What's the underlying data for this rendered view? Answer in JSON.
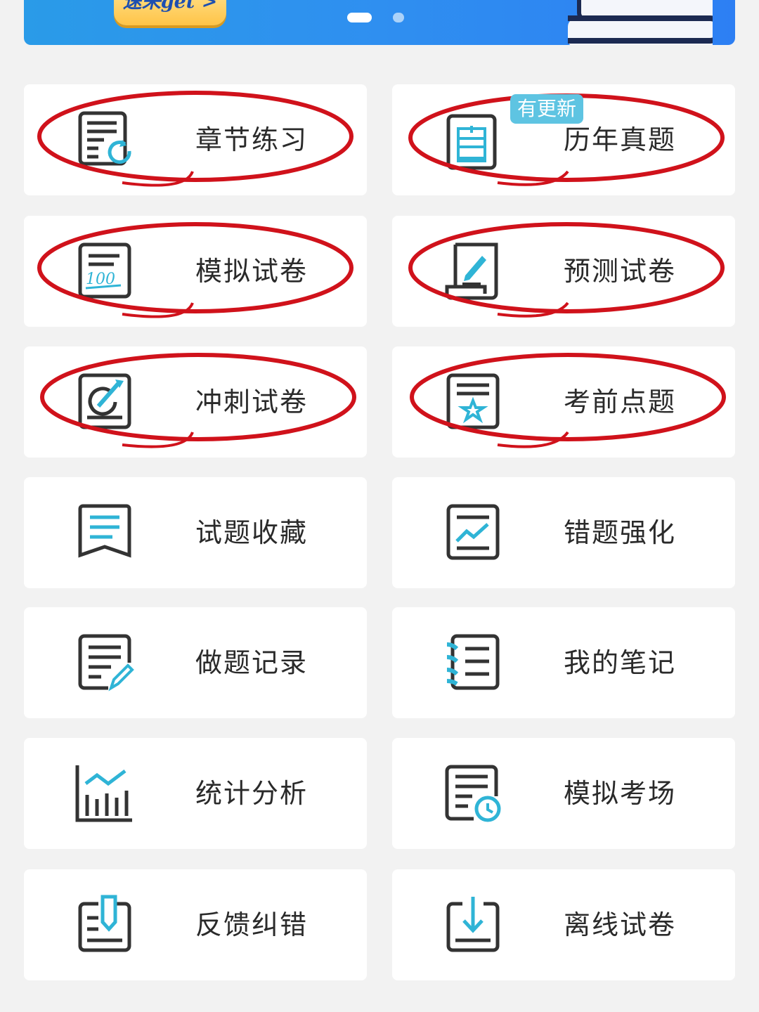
{
  "banner": {
    "button_label": "速来get >",
    "carousel_active_index": 0,
    "carousel_count": 2
  },
  "colors": {
    "accent": "#2fb4d6",
    "icon_stroke": "#333333",
    "circle_annotation": "#d0121b",
    "badge_bg": "#5ec4e2"
  },
  "grid": [
    {
      "label": "章节练习",
      "icon": "chapter-practice-icon",
      "circled": true
    },
    {
      "label": "历年真题",
      "icon": "past-exams-icon",
      "circled": true,
      "badge": "有更新"
    },
    {
      "label": "模拟试卷",
      "icon": "mock-paper-icon",
      "circled": true
    },
    {
      "label": "预测试卷",
      "icon": "forecast-paper-icon",
      "circled": true
    },
    {
      "label": "冲刺试卷",
      "icon": "sprint-paper-icon",
      "circled": true
    },
    {
      "label": "考前点题",
      "icon": "pre-exam-tips-icon",
      "circled": true
    },
    {
      "label": "试题收藏",
      "icon": "bookmark-icon",
      "circled": false
    },
    {
      "label": "错题强化",
      "icon": "wrong-questions-icon",
      "circled": false
    },
    {
      "label": "做题记录",
      "icon": "practice-record-icon",
      "circled": false
    },
    {
      "label": "我的笔记",
      "icon": "notebook-icon",
      "circled": false
    },
    {
      "label": "统计分析",
      "icon": "statistics-icon",
      "circled": false
    },
    {
      "label": "模拟考场",
      "icon": "mock-exam-room-icon",
      "circled": false
    },
    {
      "label": "反馈纠错",
      "icon": "feedback-icon",
      "circled": false
    },
    {
      "label": "离线试卷",
      "icon": "offline-download-icon",
      "circled": false
    }
  ]
}
